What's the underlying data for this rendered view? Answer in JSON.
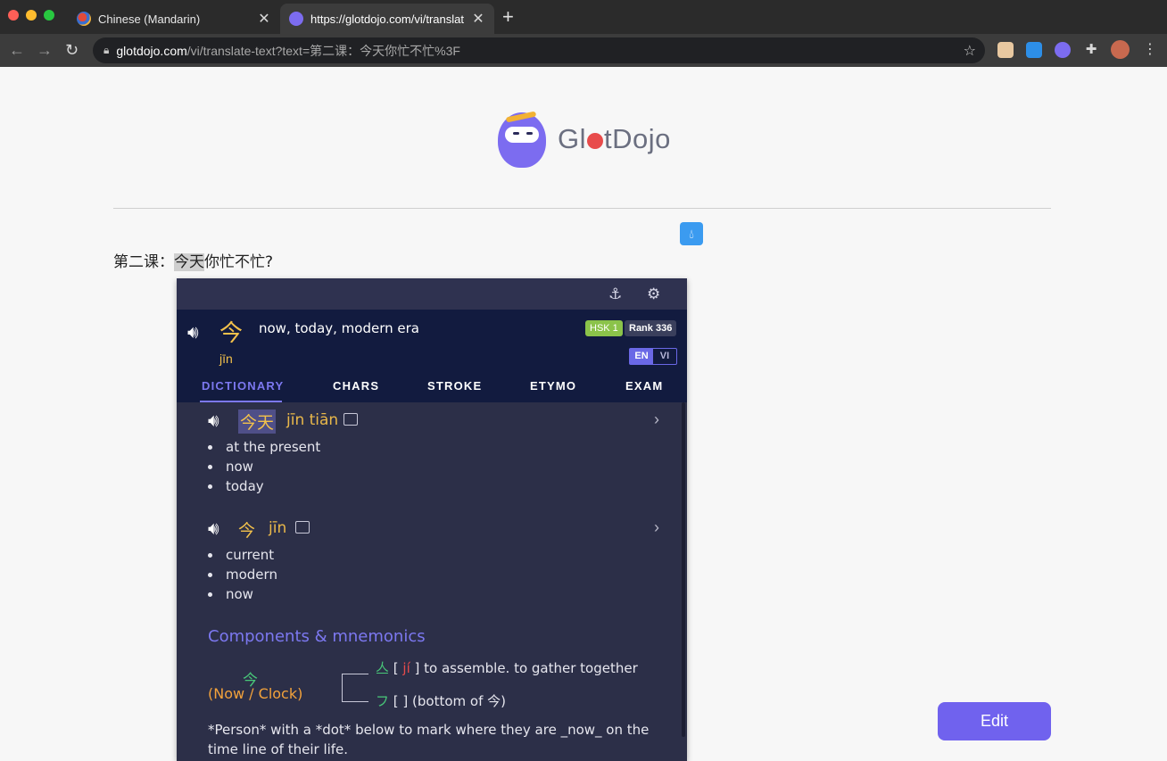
{
  "browser": {
    "tabs": [
      {
        "title": "Chinese (Mandarin)",
        "active": false
      },
      {
        "title": "https://glotdojo.com/vi/translat",
        "active": true
      }
    ],
    "url_host": "glotdojo.com",
    "url_path": "/vi/translate-text?text=第二课：今天你忙不忙%3F"
  },
  "page": {
    "logo_text_a": "Gl",
    "logo_text_b": "tDojo",
    "sentence_before": "第二课：",
    "sentence_highlight": "今天",
    "sentence_after": "你忙不忙?",
    "edit_label": "Edit"
  },
  "popup": {
    "head": {
      "char": "今",
      "definition": "now, today, modern era",
      "pinyin": "jīn",
      "hsk": "HSK 1",
      "rank": "Rank 336",
      "lang_en": "EN",
      "lang_vi": "VI"
    },
    "tabs": [
      "DICTIONARY",
      "CHARS",
      "STROKE",
      "ETYMO",
      "EXAM"
    ],
    "active_tab": "DICTIONARY",
    "entries": [
      {
        "word": "今天",
        "pinyin": "jīn tiān",
        "senses": [
          "at the present",
          "now",
          "today"
        ]
      },
      {
        "word": "今",
        "pinyin": "jīn",
        "senses": [
          "current",
          "modern",
          "now"
        ]
      }
    ],
    "components": {
      "title": "Components & mnemonics",
      "char": "今",
      "label": "(Now / Clock)",
      "parts": [
        {
          "char": "亼",
          "bracket_open": " [ ",
          "pinyin": "jí",
          "bracket_close": " ] ",
          "meaning": "to assemble. to gather together"
        },
        {
          "char": "フ",
          "bracket_open": " [ ",
          "pinyin": "",
          "bracket_close": "] ",
          "meaning": "(bottom of 今)"
        }
      ],
      "mnemonic": "*Person* with a *dot* below to mark where they are _now_ on the time line of their life."
    }
  },
  "colors": {
    "accent": "#7062ee",
    "popup_bg": "#2c2f48",
    "popup_head_bg": "#121b3f",
    "hanzi_yellow": "#f3c14b",
    "component_green": "#48c879"
  },
  "icons": {
    "speaker": "speaker-icon",
    "anchor": "anchor-icon",
    "settings": "gear-icon",
    "image": "image-icon",
    "chevron": "chevron-right-icon",
    "drop": "water-drop-icon"
  }
}
